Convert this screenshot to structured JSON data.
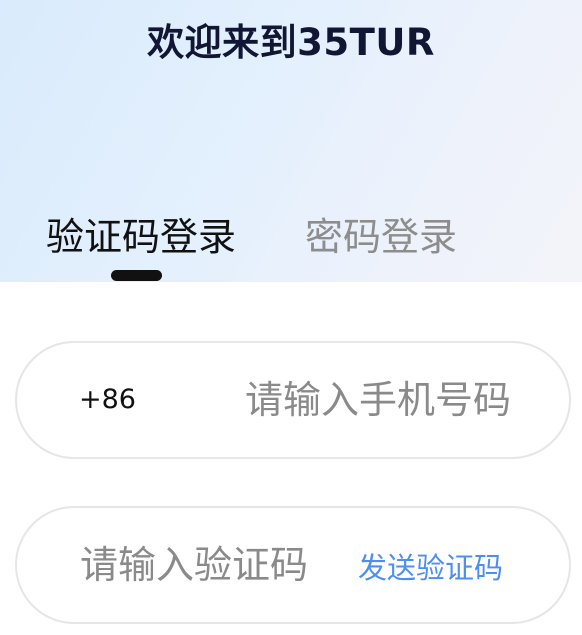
{
  "header": {
    "welcome_title": "欢迎来到35TUR"
  },
  "tabs": [
    {
      "label": "验证码登录",
      "active": true
    },
    {
      "label": "密码登录",
      "active": false
    }
  ],
  "phone_field": {
    "country_code": "+86",
    "value": "",
    "placeholder": "请输入手机号码"
  },
  "code_field": {
    "value": "",
    "placeholder": "请输入验证码",
    "send_code_label": "发送验证码"
  },
  "colors": {
    "active_tab": "#111111",
    "inactive_tab": "#8d8d8d",
    "link": "#4d8ff0",
    "title": "#101633"
  }
}
